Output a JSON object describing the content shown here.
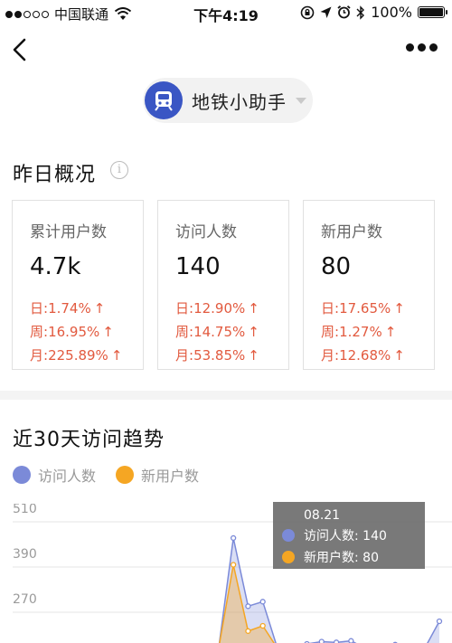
{
  "status_bar": {
    "carrier": "中国联通",
    "time": "下午4:19",
    "battery": "100%",
    "battery_level": 1.0
  },
  "nav": {
    "back_icon": "chevron-left-icon",
    "more_icon": "more-dots-icon",
    "app_name": "地铁小助手",
    "app_logo_icon": "subway-train-icon",
    "accent_color": "#3a56c4"
  },
  "overview": {
    "title": "昨日概况",
    "info_icon": "i",
    "cards": [
      {
        "label": "累计用户数",
        "value": "4.7k",
        "stats": [
          {
            "period": "日:",
            "value": "1.74%"
          },
          {
            "period": "周:",
            "value": "16.95%"
          },
          {
            "period": "月:",
            "value": "225.89%"
          }
        ]
      },
      {
        "label": "访问人数",
        "value": "140",
        "stats": [
          {
            "period": "日:",
            "value": "12.90%"
          },
          {
            "period": "周:",
            "value": "14.75%"
          },
          {
            "period": "月:",
            "value": "53.85%"
          }
        ]
      },
      {
        "label": "新用户数",
        "value": "80",
        "stats": [
          {
            "period": "日:",
            "value": "17.65%"
          },
          {
            "period": "周:",
            "value": "1.27%"
          },
          {
            "period": "月:",
            "value": "12.68%"
          }
        ]
      }
    ],
    "up_arrow": "↑",
    "up_color": "#e25a3f"
  },
  "trend": {
    "title": "近30天访问趋势",
    "legend": [
      {
        "label": "访问人数",
        "color": "#7b8ad8"
      },
      {
        "label": "新用户数",
        "color": "#f5a623"
      }
    ],
    "tooltip": {
      "date": "08.21",
      "rows": [
        {
          "label": "访问人数: 140",
          "color": "#7b8ad8"
        },
        {
          "label": "新用户数: 80",
          "color": "#f5a623"
        }
      ]
    }
  },
  "chart_data": {
    "type": "area",
    "title": "近30天访问趋势",
    "y_ticks": [
      "510",
      "390",
      "270"
    ],
    "ylim": [
      150,
      510
    ],
    "x_count": 30,
    "series": [
      {
        "name": "访问人数",
        "color": "#7b8ad8",
        "points": [
          [
            11,
            150
          ],
          [
            12,
            152
          ],
          [
            13,
            150
          ],
          [
            14,
            150
          ],
          [
            15,
            150
          ],
          [
            16,
            443
          ],
          [
            17,
            262
          ],
          [
            18,
            274
          ],
          [
            19,
            150
          ],
          [
            20,
            150
          ],
          [
            21,
            162
          ],
          [
            22,
            168
          ],
          [
            23,
            166
          ],
          [
            24,
            170
          ],
          [
            25,
            150
          ],
          [
            26,
            150
          ],
          [
            27,
            160
          ],
          [
            28,
            150
          ],
          [
            29,
            150
          ],
          [
            30,
            222
          ]
        ]
      },
      {
        "name": "新用户数",
        "color": "#f5a623",
        "points": [
          [
            11,
            150
          ],
          [
            12,
            150
          ],
          [
            13,
            150
          ],
          [
            14,
            150
          ],
          [
            15,
            150
          ],
          [
            16,
            372
          ],
          [
            17,
            196
          ],
          [
            18,
            210
          ],
          [
            19,
            150
          ],
          [
            20,
            150
          ],
          [
            21,
            150
          ],
          [
            22,
            150
          ],
          [
            23,
            150
          ],
          [
            24,
            150
          ],
          [
            25,
            150
          ],
          [
            26,
            150
          ],
          [
            27,
            150
          ],
          [
            28,
            150
          ],
          [
            29,
            150
          ],
          [
            30,
            150
          ]
        ]
      }
    ]
  }
}
